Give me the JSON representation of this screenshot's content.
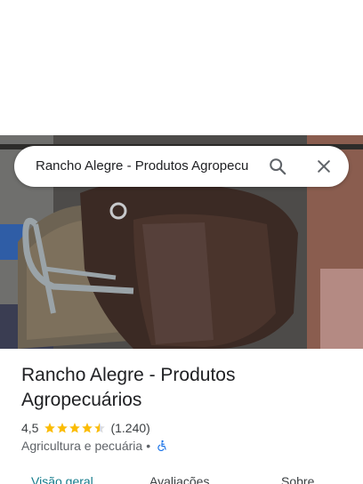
{
  "search": {
    "value": "Rancho Alegre - Produtos Agropecu"
  },
  "place": {
    "title": "Rancho Alegre - Produtos Agropecuários",
    "rating": "4,5",
    "stars": 4.5,
    "review_count": "(1.240)",
    "category": "Agricultura e pecuária",
    "separator": "•"
  },
  "tabs": [
    {
      "label": "Visão geral",
      "active": true
    },
    {
      "label": "Avaliações",
      "active": false
    },
    {
      "label": "Sobre",
      "active": false
    }
  ],
  "colors": {
    "star": "#fbbc04",
    "active_tab": "#137b8b",
    "accessibility_icon": "#1a73e8"
  },
  "icons": {
    "search": "search-icon",
    "close": "close-icon",
    "accessibility": "wheelchair-icon"
  }
}
